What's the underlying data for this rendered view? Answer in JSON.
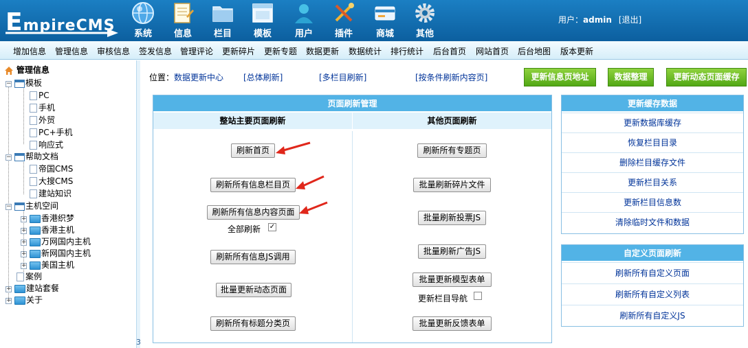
{
  "header": {
    "logo_text": "EmpireCMS",
    "nav": [
      {
        "label": "系统",
        "icon": "globe-icon"
      },
      {
        "label": "信息",
        "icon": "notepad-icon"
      },
      {
        "label": "栏目",
        "icon": "folder-icon"
      },
      {
        "label": "模板",
        "icon": "window-icon"
      },
      {
        "label": "用户",
        "icon": "user-icon"
      },
      {
        "label": "插件",
        "icon": "tools-icon"
      },
      {
        "label": "商城",
        "icon": "credit-card-icon"
      },
      {
        "label": "其他",
        "icon": "gear-icon"
      }
    ],
    "user_label": "用户：",
    "username": "admin",
    "logout": "[退出]"
  },
  "menubar": [
    "增加信息",
    "管理信息",
    "审核信息",
    "签发信息",
    "管理评论",
    "更新碎片",
    "更新专题",
    "数据更新",
    "数据统计",
    "排行统计",
    "后台首页",
    "网站首页",
    "后台地图",
    "版本更新"
  ],
  "tree": {
    "root": "管理信息",
    "nodes": {
      "templates": "模板",
      "pc": "PC",
      "mobile": "手机",
      "trade": "外贸",
      "pc_mobile": "PC+手机",
      "responsive": "响应式",
      "help": "帮助文档",
      "empire": "帝国CMS",
      "dasou": "大搜CMS",
      "knowledge": "建站知识",
      "host": "主机空间",
      "hk_zhimeng": "香港织梦",
      "hk_host": "香港主机",
      "wanwang": "万网国内主机",
      "xinwang": "新网国内主机",
      "us_host": "美国主机",
      "cases": "案例",
      "packages": "建站套餐",
      "about": "关于"
    },
    "footer_num": "3"
  },
  "location": {
    "label": "位置：",
    "current": "数据更新中心",
    "links": [
      "[总体刷新]",
      "[多栏目刷新]",
      "[按条件刷新内容页]"
    ]
  },
  "green_buttons": [
    "更新信息页地址",
    "数据整理",
    "更新动态页面缓存"
  ],
  "refresh_panel": {
    "title": "页面刷新管理",
    "left_header": "整站主要页面刷新",
    "right_header": "其他页面刷新",
    "left_buttons": [
      "刷新首页",
      "刷新所有信息栏目页",
      "刷新所有信息内容页面",
      "刷新所有信息JS调用",
      "批量更新动态页面",
      "刷新所有标题分类页"
    ],
    "all_refresh_label": "全部刷新",
    "all_refresh_checked": true,
    "right_buttons": [
      "刷新所有专题页",
      "批量刷新碎片文件",
      "批量刷新投票JS",
      "批量刷新广告JS",
      "批量更新模型表单",
      "批量更新反馈表单"
    ],
    "update_nav_label": "更新栏目导航",
    "update_nav_checked": false
  },
  "cache_panel": {
    "title": "更新缓存数据",
    "items": [
      "更新数据库缓存",
      "恢复栏目目录",
      "删除栏目缓存文件",
      "更新栏目关系",
      "更新栏目信息数",
      "清除临时文件和数据"
    ]
  },
  "custom_panel": {
    "title": "自定义页面刷新",
    "items": [
      "刷新所有自定义页面",
      "刷新所有自定义列表",
      "刷新所有自定义JS"
    ]
  },
  "colors": {
    "header_bg": "#0e67a8",
    "panel_title_bg": "#52b3e6",
    "green_button": "#6abf23",
    "arrow_red": "#e0271b"
  }
}
